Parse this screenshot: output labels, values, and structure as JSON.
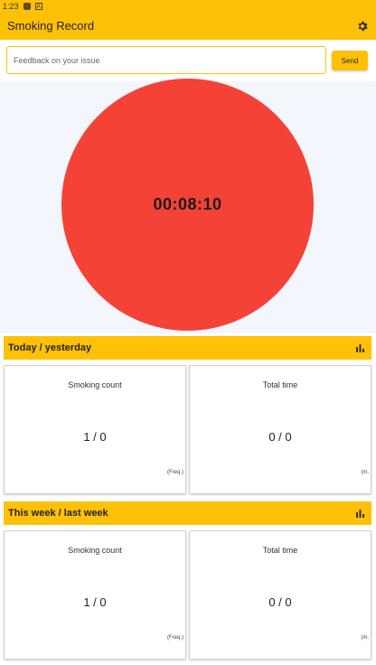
{
  "status_bar": {
    "time": "1:23",
    "notif_letter": "A"
  },
  "app_bar": {
    "title": "Smoking Record"
  },
  "feedback": {
    "placeholder": "Feedback on your issue",
    "send_label": "Send"
  },
  "timer": {
    "value": "00:08:10"
  },
  "sections": [
    {
      "title": "Today / yesterday",
      "cards": [
        {
          "title": "Smoking count",
          "value": "1 / 0",
          "unit": "(Freq.)"
        },
        {
          "title": "Total time",
          "value": "0 / 0",
          "unit": "(m."
        }
      ]
    },
    {
      "title": "This week / last week",
      "cards": [
        {
          "title": "Smoking count",
          "value": "1 / 0",
          "unit": "(Freq.)"
        },
        {
          "title": "Total time",
          "value": "0 / 0",
          "unit": "(m."
        }
      ]
    }
  ],
  "colors": {
    "accent": "#FFC107",
    "timer": "#F44336",
    "circle_bg": "#f3f6fc"
  },
  "icons": {
    "settings": "gear-icon",
    "stats": "bar-chart-icon"
  }
}
